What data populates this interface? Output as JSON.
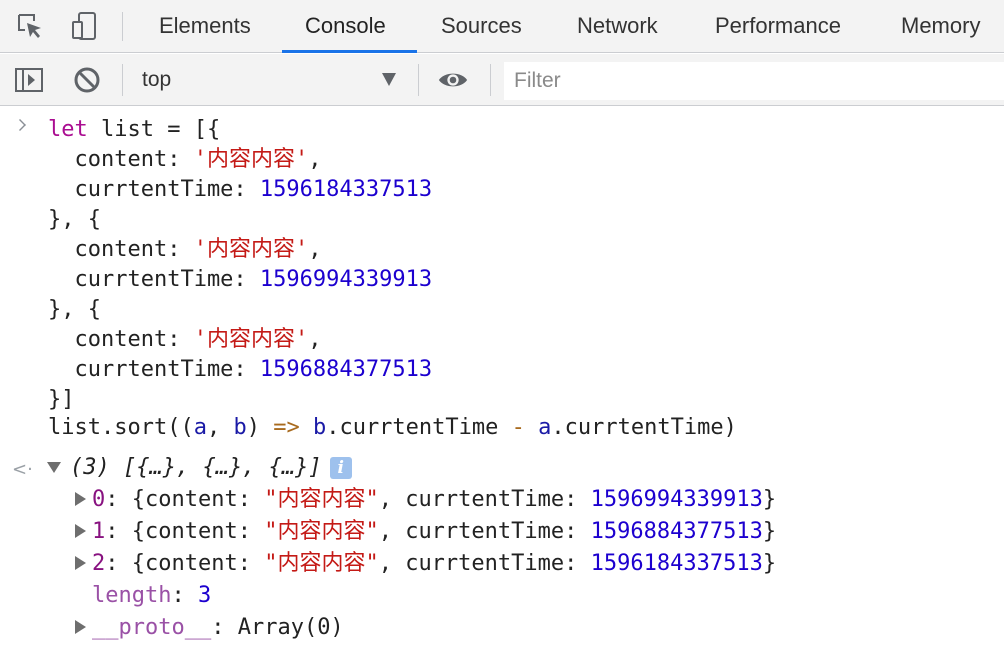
{
  "tabs": [
    {
      "label": "Elements"
    },
    {
      "label": "Console"
    },
    {
      "label": "Sources"
    },
    {
      "label": "Network"
    },
    {
      "label": "Performance"
    },
    {
      "label": "Memory"
    }
  ],
  "active_tab": "Console",
  "toolbar": {
    "context": "top",
    "filter_placeholder": "Filter"
  },
  "input": {
    "l1_kw": "let",
    "l1_rest": " list = [{",
    "obj_open": "}, {",
    "content_key": "  content: ",
    "content_val": "'内容内容'",
    "comma": ",",
    "time_key": "  currtentTime: ",
    "times": [
      "1596184337513",
      "1596994339913",
      "1596884377513"
    ],
    "close": "}]",
    "sort_a": "list.sort((",
    "sort_param_a": "a",
    "sort_comma": ", ",
    "sort_param_b": "b",
    "sort_b": ") ",
    "sort_arrow": "=>",
    "sort_sp": " ",
    "sort_body_b": "b",
    "sort_body_mid": ".currtentTime ",
    "sort_minus": "-",
    "sort_sp2": " ",
    "sort_body_a": "a",
    "sort_body_end": ".currtentTime)"
  },
  "output": {
    "summary": "(3) [{…}, {…}, {…}]",
    "info": "i",
    "rows": [
      {
        "index": "0",
        "content": "\"内容内容\"",
        "time": "1596994339913"
      },
      {
        "index": "1",
        "content": "\"内容内容\"",
        "time": "1596884377513"
      },
      {
        "index": "2",
        "content": "\"内容内容\"",
        "time": "1596184337513"
      }
    ],
    "row_content_key": "{content: ",
    "row_time_key": ", currtentTime: ",
    "row_close": "}",
    "colon": ": ",
    "length_key": "length",
    "length_val": "3",
    "proto_key": "__proto__",
    "proto_val": "Array(0)"
  }
}
